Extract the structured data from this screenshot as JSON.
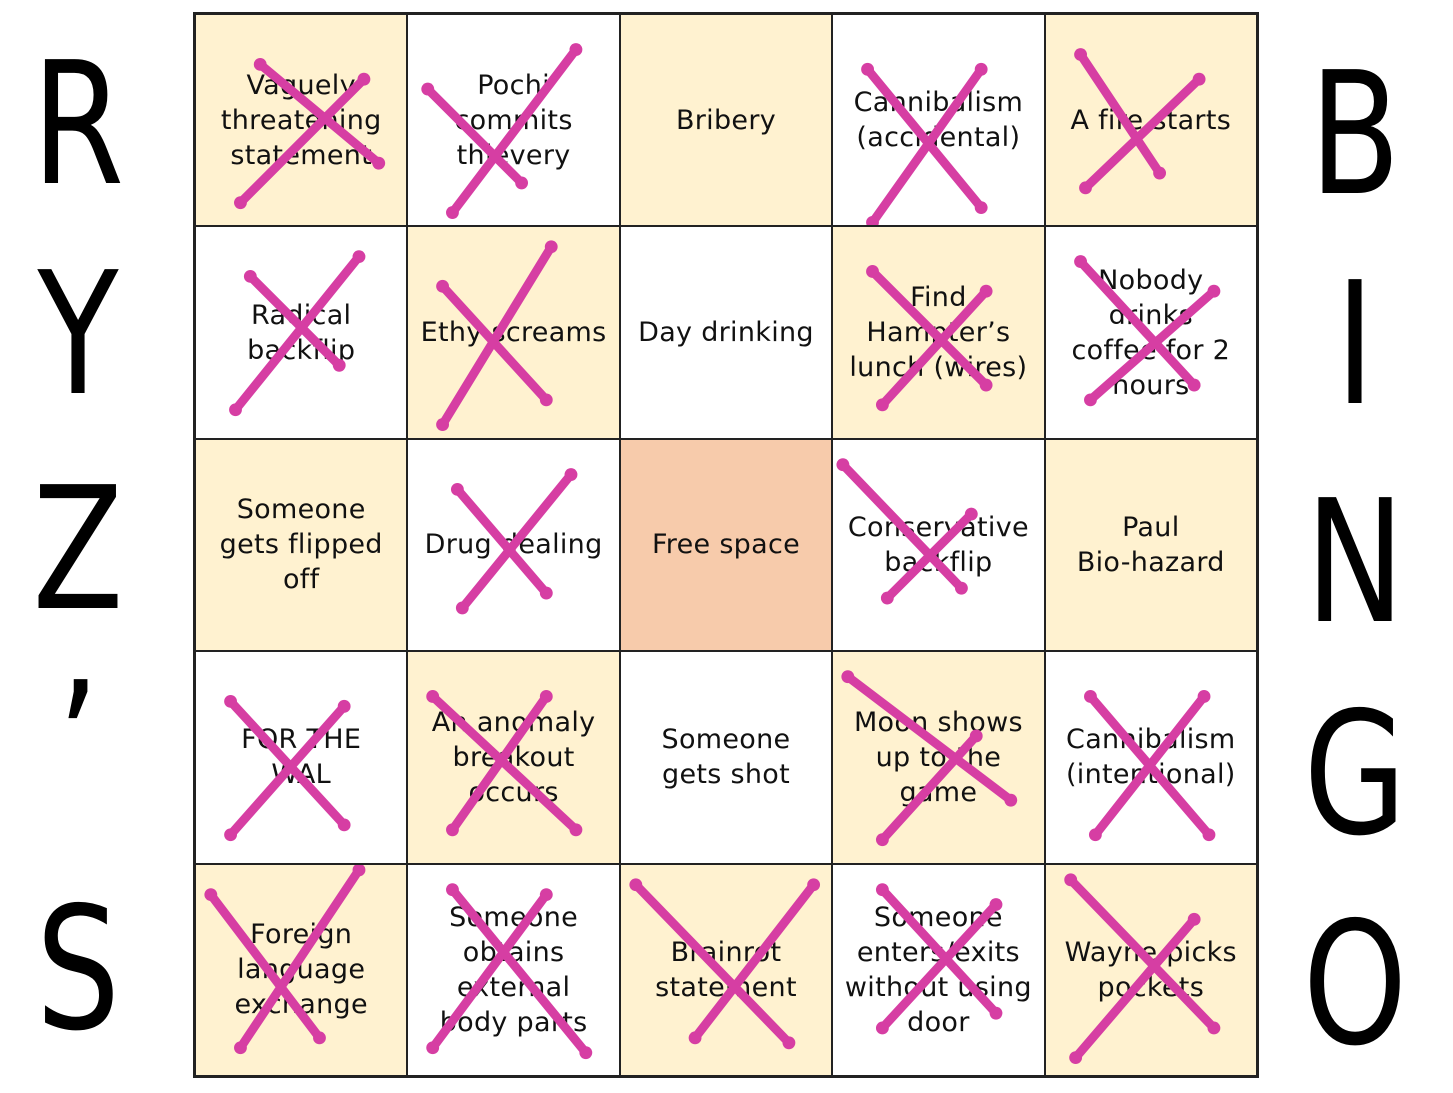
{
  "left_word": [
    "R",
    "Y",
    "Z",
    "’",
    "S"
  ],
  "right_word": [
    "B",
    "I",
    "N",
    "G",
    "O"
  ],
  "mark_color": "#d63ea3",
  "colors": {
    "cream": "#fff2d0",
    "white": "#ffffff",
    "peach": "#f7cbab"
  },
  "cells": [
    {
      "text": "Vaguely\nthreatening\nstatement",
      "fill": "cream",
      "marked": true
    },
    {
      "text": "Pochi\ncommits\nthievery",
      "fill": "white",
      "marked": true
    },
    {
      "text": "Bribery",
      "fill": "cream",
      "marked": false
    },
    {
      "text": "Cannibalism\n(accidental)",
      "fill": "white",
      "marked": true
    },
    {
      "text": "A fire starts",
      "fill": "cream",
      "marked": true
    },
    {
      "text": "Radical\nbackflip",
      "fill": "white",
      "marked": true
    },
    {
      "text": "Ethy screams",
      "fill": "cream",
      "marked": true
    },
    {
      "text": "Day drinking",
      "fill": "white",
      "marked": false
    },
    {
      "text": "Find\nHampter’s\nlunch (wires)",
      "fill": "cream",
      "marked": true
    },
    {
      "text": "Nobody\ndrinks\ncoffee for 2\nhours",
      "fill": "white",
      "marked": true
    },
    {
      "text": "Someone\ngets flipped\noff",
      "fill": "cream",
      "marked": false
    },
    {
      "text": "Drug dealing",
      "fill": "white",
      "marked": true
    },
    {
      "text": "Free space",
      "fill": "peach",
      "marked": false
    },
    {
      "text": "Conservative\nbackflip",
      "fill": "white",
      "marked": true
    },
    {
      "text": "Paul\nBio-hazard",
      "fill": "cream",
      "marked": false
    },
    {
      "text": "FOR THE\nWAL",
      "fill": "white",
      "marked": true
    },
    {
      "text": "An anomaly\nbreakout\noccurs",
      "fill": "cream",
      "marked": true
    },
    {
      "text": "Someone\ngets shot",
      "fill": "white",
      "marked": false
    },
    {
      "text": "Moon shows\nup to the\ngame",
      "fill": "cream",
      "marked": true
    },
    {
      "text": "Cannibalism\n(intentional)",
      "fill": "white",
      "marked": true
    },
    {
      "text": "Foreign\nlanguage\nexchange",
      "fill": "cream",
      "marked": true
    },
    {
      "text": "Someone\nobtains\nexternal\nbody parts",
      "fill": "white",
      "marked": true
    },
    {
      "text": "Brainrot\nstatement",
      "fill": "cream",
      "marked": true
    },
    {
      "text": "Someone\nenters/exits\nwithout using\ndoor",
      "fill": "white",
      "marked": true
    },
    {
      "text": "Wayne picks\npockets",
      "fill": "cream",
      "marked": true
    }
  ]
}
